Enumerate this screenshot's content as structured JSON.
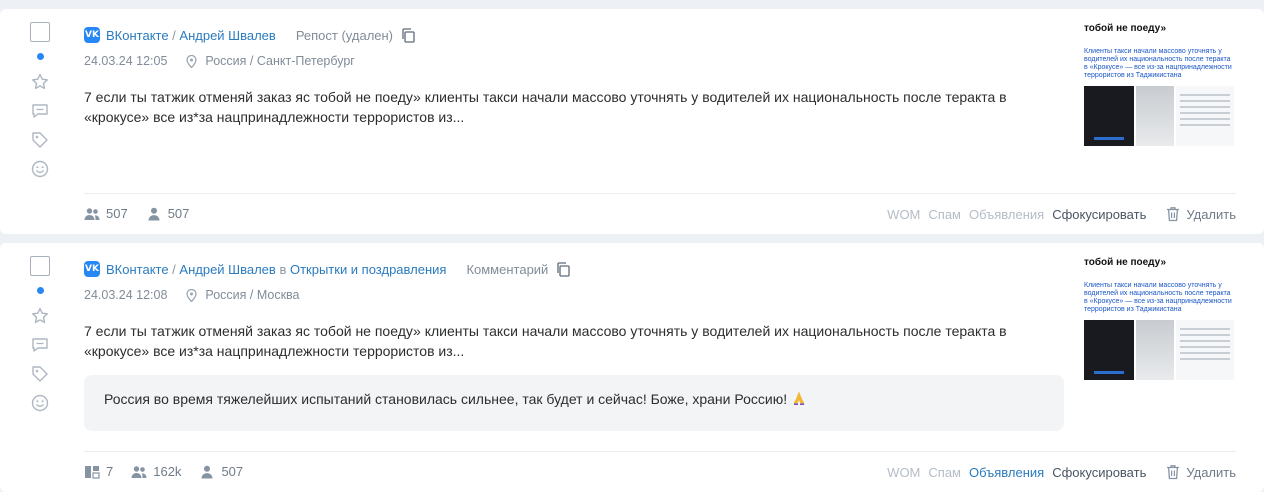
{
  "posts": [
    {
      "source": "ВКонтакте",
      "author": "Андрей Швалев",
      "author_context_prefix": "",
      "author_context": "",
      "type_label": "Репост (удален)",
      "datetime": "24.03.24 12:05",
      "location": "Россия / Санкт-Петербург",
      "text_line1": "7 если ты татжик отменяй заказ яс тобой не поеду» клиенты такси начали массово уточнять у водителей их национальность после теракта в",
      "text_line2": "«крокусе» все из*за нацпринадлежности террористов из...",
      "quote": "",
      "thumbnail": {
        "title": "тобой не поеду»",
        "subtitle": "Клиенты такси начали массово уточнять у водителей их национальность после теракта в «Крокусе» — все из-за нацпринадлежности террористов из Таджикистана"
      },
      "stats": [
        {
          "icon": "users-icon",
          "value": "507"
        },
        {
          "icon": "user-icon",
          "value": "507"
        }
      ],
      "actions": {
        "wom": "WOM",
        "spam": "Спам",
        "ads": "Объявления",
        "focus": "Сфокусировать",
        "delete": "Удалить"
      }
    },
    {
      "source": "ВКонтакте",
      "author": "Андрей Швалев",
      "author_context_prefix": "в",
      "author_context": "Открытки и поздравления",
      "type_label": "Комментарий",
      "datetime": "24.03.24 12:08",
      "location": "Россия / Москва",
      "text_line1": "7 если ты татжик отменяй заказ яс тобой не поеду» клиенты такси начали массово уточнять у водителей их национальность после теракта в",
      "text_line2": "«крокусе» все из*за нацпринадлежности террористов из...",
      "quote": "Россия во время тяжелейших испытаний становилась сильнее, так будет и сейчас! Боже, храни Россию!",
      "thumbnail": {
        "title": "тобой не поеду»",
        "subtitle": "Клиенты такси начали массово уточнять у водителей их национальность после теракта в «Крокусе» — все из-за нацпринадлежности террористов из Таджикистана"
      },
      "stats": [
        {
          "icon": "posts-icon",
          "value": "7"
        },
        {
          "icon": "users-icon",
          "value": "162k"
        },
        {
          "icon": "user-icon",
          "value": "507"
        }
      ],
      "actions": {
        "wom": "WOM",
        "spam": "Спам",
        "ads": "Объявления",
        "focus": "Сфокусировать",
        "delete": "Удалить"
      }
    }
  ],
  "colors": {
    "link": "#2a7bbf",
    "accent": "#2787f5",
    "muted": "#b4bcc6"
  }
}
